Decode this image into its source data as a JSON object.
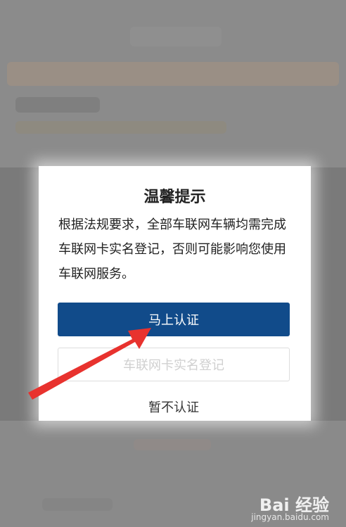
{
  "dialog": {
    "title": "温馨提示",
    "message": "根据法规要求，全部车联网车辆均需完成车联网卡实名登记，否则可能影响您使用车联网服务。",
    "primary_button": "马上认证",
    "secondary_button": "车联网卡实名登记",
    "tertiary_button": "暂不认证"
  },
  "watermark": {
    "brand": "Bai 经验",
    "url": "jingyan.baidu.com"
  },
  "colors": {
    "primary": "#114b8a",
    "arrow": "#e8322e",
    "overlay": "#8a8a8a"
  }
}
